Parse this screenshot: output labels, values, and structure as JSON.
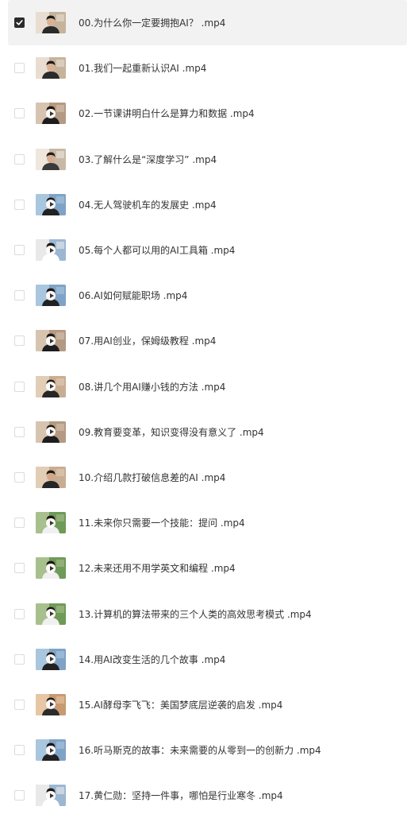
{
  "files": [
    {
      "name": "00.为什么你一定要拥抱AI？ .mp4",
      "checked": true,
      "thumb_style": 0,
      "play_icon": false
    },
    {
      "name": "01.我们一起重新认识AI .mp4",
      "checked": false,
      "thumb_style": 0,
      "play_icon": false
    },
    {
      "name": "02.一节课讲明白什么是算力和数据 .mp4",
      "checked": false,
      "thumb_style": 1,
      "play_icon": true
    },
    {
      "name": "03.了解什么是“深度学习” .mp4",
      "checked": false,
      "thumb_style": 2,
      "play_icon": false
    },
    {
      "name": "04.无人驾驶机车的发展史 .mp4",
      "checked": false,
      "thumb_style": 3,
      "play_icon": true
    },
    {
      "name": "05.每个人都可以用的AI工具箱 .mp4",
      "checked": false,
      "thumb_style": 4,
      "play_icon": true
    },
    {
      "name": "06.AI如何赋能职场 .mp4",
      "checked": false,
      "thumb_style": 3,
      "play_icon": true
    },
    {
      "name": "07.用AI创业，保姆级教程 .mp4",
      "checked": false,
      "thumb_style": 1,
      "play_icon": true
    },
    {
      "name": "08.讲几个用AI赚小钱的方法 .mp4",
      "checked": false,
      "thumb_style": 5,
      "play_icon": true
    },
    {
      "name": "09.教育要变革，知识变得没有意义了 .mp4",
      "checked": false,
      "thumb_style": 1,
      "play_icon": true
    },
    {
      "name": "10.介绍几款打破信息差的AI .mp4",
      "checked": false,
      "thumb_style": 5,
      "play_icon": false
    },
    {
      "name": "11.未来你只需要一个技能：提问 .mp4",
      "checked": false,
      "thumb_style": 6,
      "play_icon": true
    },
    {
      "name": "12.未来还用不用学英文和编程 .mp4",
      "checked": false,
      "thumb_style": 6,
      "play_icon": true
    },
    {
      "name": "13.计算机的算法带来的三个人类的高效思考模式 .mp4",
      "checked": false,
      "thumb_style": 6,
      "play_icon": true
    },
    {
      "name": "14.用AI改变生活的几个故事 .mp4",
      "checked": false,
      "thumb_style": 3,
      "play_icon": true
    },
    {
      "name": "15.AI酵母李飞飞：美国梦底层逆袭的启发 .mp4",
      "checked": false,
      "thumb_style": 7,
      "play_icon": true
    },
    {
      "name": "16.听马斯克的故事：未来需要的从零到一的创新力 .mp4",
      "checked": false,
      "thumb_style": 3,
      "play_icon": true
    },
    {
      "name": "17.黄仁勋：坚持一件事，哪怕是行业寒冬 .mp4",
      "checked": false,
      "thumb_style": 4,
      "play_icon": true
    }
  ],
  "thumb_palettes": [
    {
      "bg": "#c6b39b",
      "wall": "#e8ddd0",
      "shirt": "#2a2a2a",
      "skin": "#d9b196",
      "hair": "#1e1a17"
    },
    {
      "bg": "#b49a82",
      "wall": "#d7c4b0",
      "shirt": "#1d1d1d",
      "skin": "#cfa486",
      "hair": "#1b1714"
    },
    {
      "bg": "#c8b8a6",
      "wall": "#efe7dc",
      "shirt": "#3a3a3a",
      "skin": "#d5ad90",
      "hair": "#231e1a"
    },
    {
      "bg": "#7fa3c6",
      "wall": "#a9c6df",
      "shirt": "#222222",
      "skin": "#d4aa8c",
      "hair": "#1a1715"
    },
    {
      "bg": "#9bb7d2",
      "wall": "#e9e9e9",
      "shirt": "#ffffff",
      "skin": "#d8b297",
      "hair": "#1c1816"
    },
    {
      "bg": "#c9ad92",
      "wall": "#e2cdb6",
      "shirt": "#262626",
      "skin": "#d3a88a",
      "hair": "#1d1916"
    },
    {
      "bg": "#6f9a58",
      "wall": "#a7c08d",
      "shirt": "#f0f0f0",
      "skin": "#d6ae92",
      "hair": "#1b1815"
    },
    {
      "bg": "#c79a72",
      "wall": "#e6c6a4",
      "shirt": "#2b2b2b",
      "skin": "#d2a383",
      "hair": "#1c1815"
    }
  ]
}
